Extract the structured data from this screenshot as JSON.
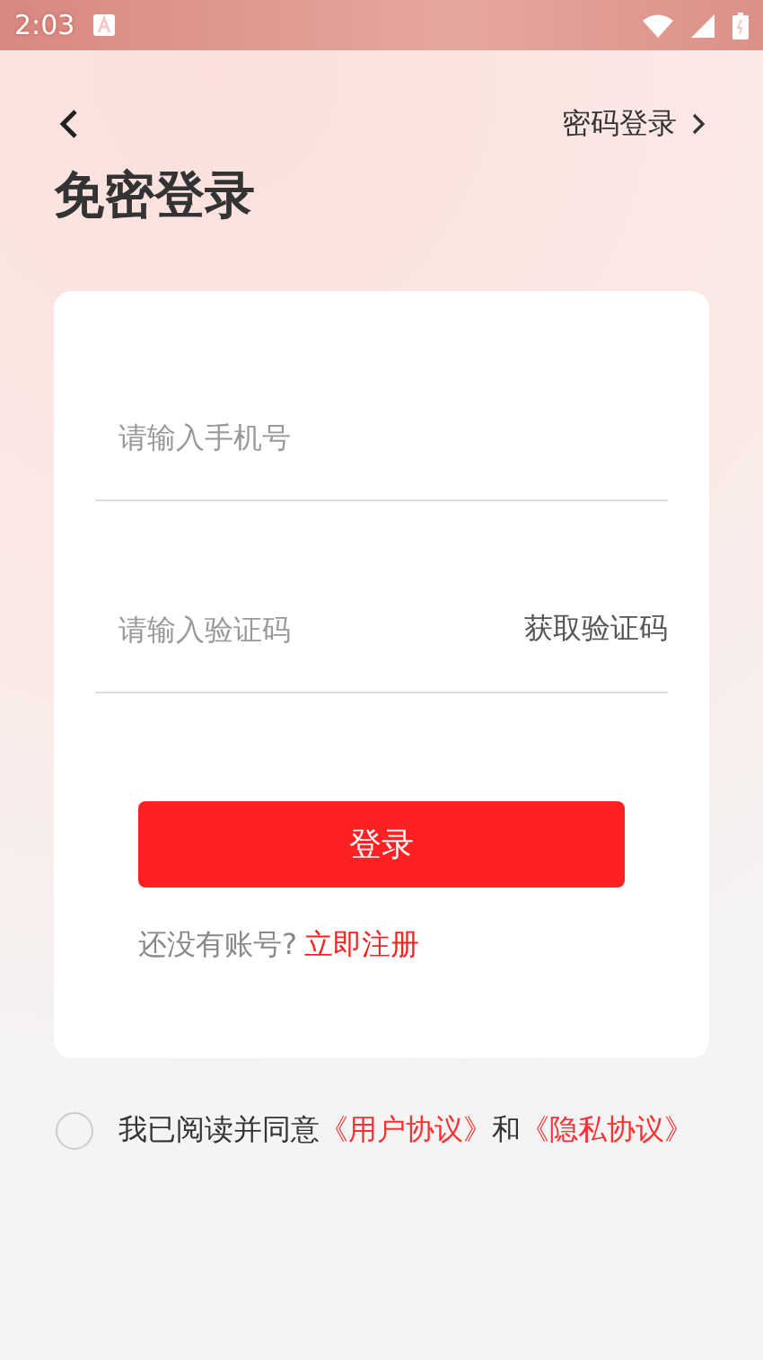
{
  "status_bar": {
    "time": "2:03"
  },
  "nav": {
    "right_link": "密码登录"
  },
  "title": "免密登录",
  "form": {
    "phone": {
      "placeholder": "请输入手机号"
    },
    "code": {
      "placeholder": "请输入验证码",
      "action": "获取验证码"
    },
    "submit": "登录",
    "register": {
      "prompt": "还没有账号?",
      "link": "立即注册"
    }
  },
  "agreement": {
    "checked": false,
    "parts": [
      {
        "kind": "text",
        "text": "我已阅读并同意"
      },
      {
        "kind": "link",
        "text": "《用户协议》"
      },
      {
        "kind": "text",
        "text": "和"
      },
      {
        "kind": "link",
        "text": "《隐私协议》"
      }
    ]
  }
}
